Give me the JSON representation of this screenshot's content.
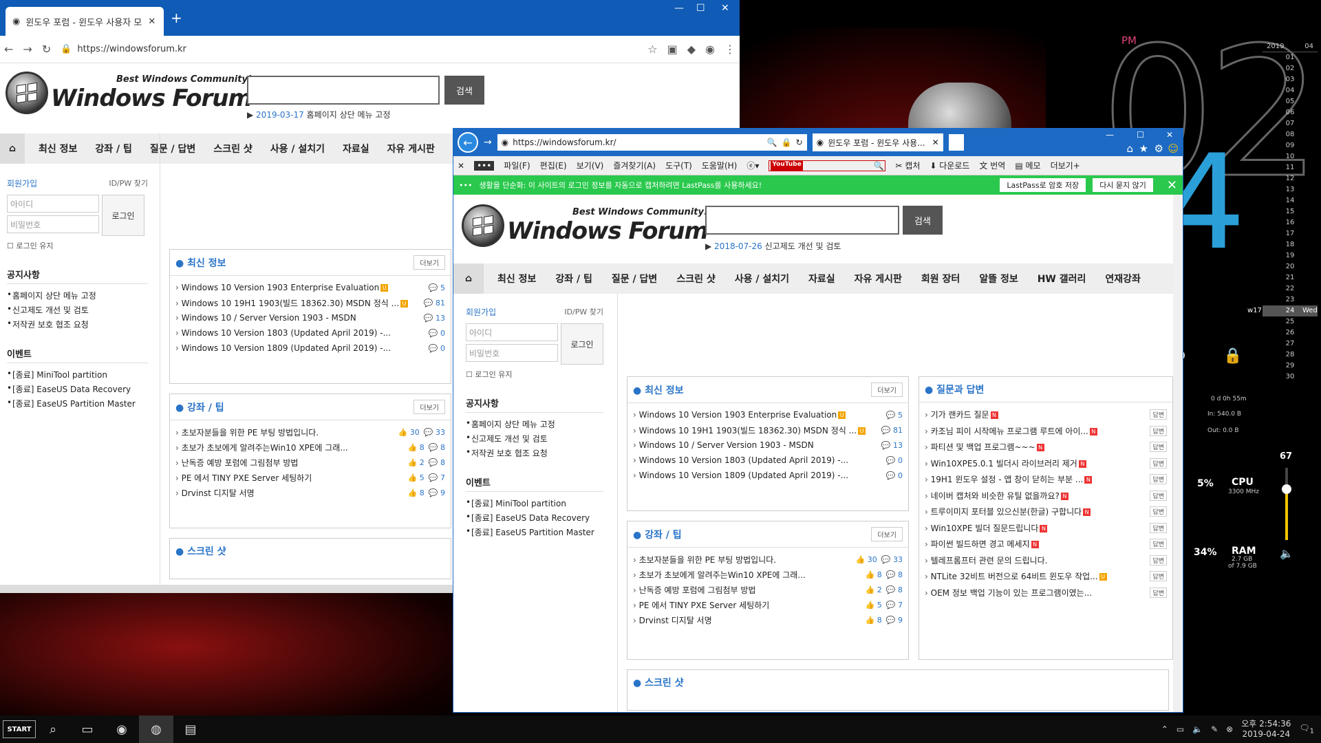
{
  "desktop": {
    "pm": "PM",
    "hour": "02",
    "minute": "4",
    "calendar": {
      "year": "2019",
      "month": "04",
      "days": [
        "01",
        "02",
        "03",
        "04",
        "05",
        "06",
        "07",
        "08",
        "09",
        "10",
        "11",
        "12",
        "13",
        "14",
        "15",
        "16",
        "17",
        "18",
        "19",
        "20",
        "21",
        "22",
        "23",
        "24",
        "25",
        "26",
        "27",
        "28",
        "29",
        "30"
      ],
      "week": "w17",
      "today": "24",
      "weekday": "Wed"
    },
    "uptime": "0 d 0h 55m",
    "net_in": "In: 540.0 B",
    "net_out": "Out: 0.0 B",
    "cpu_pct": "5%",
    "cpu_label": "CPU",
    "cpu_freq": "3300 MHz",
    "ram_pct": "34%",
    "ram_label": "RAM",
    "ram_used": "2.7 GB",
    "ram_total": "of 7.9 GB",
    "volume": "67"
  },
  "chrome": {
    "tab_title": "윈도우 포럼 - 윈도우 사용자 모임",
    "url": "https://windowsforum.kr",
    "notice_date": "2019-03-17",
    "notice_text": "홈페이지 상단 메뉴 고정"
  },
  "ie": {
    "url": "https://windowsforum.kr/",
    "tab_title": "윈도우 포럼 - 윈도우 사용...",
    "menu": [
      "파일(F)",
      "편집(E)",
      "보기(V)",
      "즐겨찾기(A)",
      "도구(T)",
      "도움말(H)"
    ],
    "toolbar": [
      "캡처",
      "다운로드",
      "번역",
      "메모",
      "더보기+"
    ],
    "youtube": "YouTube",
    "lastpass_msg": "생활을 단순화: 이 사이트의 로그인 정보를 자동으로 캡처하려면 LastPass를 사용하세요!",
    "lastpass_btn1": "LastPass로 암호 저장",
    "lastpass_btn2": "다시 묻지 않기",
    "notice_date": "2018-07-26",
    "notice_text": "신고제도 개선 및 검토"
  },
  "site": {
    "tagline": "Best Windows Community!",
    "logo": "Windows Forum",
    "search_btn": "검색",
    "nav": [
      "최신 정보",
      "강좌 / 팁",
      "질문 / 답변",
      "스크린 샷",
      "사용 / 설치기",
      "자료실",
      "자유 게시판",
      "회원 장터",
      "알뜰 정보",
      "HW 갤러리",
      "연재강좌"
    ],
    "signup": "회원가입",
    "find": "ID/PW 찾기",
    "id_ph": "아이디",
    "pw_ph": "비밀번호",
    "login": "로그인",
    "keep": "로그인 유지",
    "notice_h": "공지사항",
    "notices": [
      "홈페이지 상단 메뉴 고정",
      "신고제도 개선 및 검토",
      "저작권 보호 협조 요청"
    ],
    "event_h": "이벤트",
    "events": [
      "[종료] MiniTool partition",
      "[종료] EaseUS Data Recovery",
      "[종료] EaseUS Partition Master"
    ],
    "more": "더보기",
    "latest_h": "최신 정보",
    "latest": [
      {
        "t": "Windows 10 Version 1903 Enterprise Evaluation",
        "c": "5",
        "b": true
      },
      {
        "t": "Windows 10 19H1 1903(빌드 18362.30) MSDN 정식 ...",
        "c": "81",
        "b": true
      },
      {
        "t": "Windows 10 / Server Version 1903 - MSDN",
        "c": "13",
        "b": false
      },
      {
        "t": "Windows 10 Version 1803 (Updated April 2019) -...",
        "c": "0",
        "b": false
      },
      {
        "t": "Windows 10 Version 1809 (Updated April 2019) -...",
        "c": "0",
        "b": false
      }
    ],
    "tips_h": "강좌 / 팁",
    "tips": [
      {
        "t": "초보자분들을 위한 PE 부팅 방법입니다.",
        "l": "30",
        "c": "33"
      },
      {
        "t": "초보가 초보에게 알려주는Win10 XPE에 그래...",
        "l": "8",
        "c": "8"
      },
      {
        "t": "난독증 예방 포럼에 그림첨부 방법",
        "l": "2",
        "c": "8"
      },
      {
        "t": "PE 에서 TINY PXE Server 세팅하기",
        "l": "5",
        "c": "7"
      },
      {
        "t": "Drvinst 디지탈 서명",
        "l": "8",
        "c": "9"
      }
    ],
    "qa_h": "질문과 답변",
    "ans": "답변",
    "qa": [
      {
        "t": "기가 랜카드 질문",
        "n": "N"
      },
      {
        "t": "카조님 피이 시작메뉴 프로그램 루트에 아이...",
        "n": "N"
      },
      {
        "t": "파티션 및 백업 프로그램~~~",
        "n": "N"
      },
      {
        "t": "Win10XPE5.0.1 빌더시 라이브러리 제거",
        "n": "N"
      },
      {
        "t": "19H1 윈도우 설정 - 앱 창이 닫히는 부분 ...",
        "n": "N"
      },
      {
        "t": "네이버 캡처와 비슷한 유틸 없을까요?",
        "n": "N"
      },
      {
        "t": "트루이미지 포터블 있으신분(한글) 구합니다",
        "n": "N"
      },
      {
        "t": "Win10XPE 빌더 질문드립니다",
        "n": "N"
      },
      {
        "t": "파이썬 빌드하면 경고 메세지",
        "n": "N"
      },
      {
        "t": "텔레프롬프터 관련 문의 드립니다.",
        "n": ""
      },
      {
        "t": "NTLite 32비트 버전으로 64비트 윈도우 작업...",
        "n": "U"
      },
      {
        "t": "OEM 정보 백업 기능이 있는 프로그램이였는...",
        "n": ""
      }
    ],
    "shots_h": "스크린 샷"
  },
  "taskbar": {
    "start": "START",
    "time": "오후 2:54:36",
    "date": "2019-04-24",
    "notif": "1"
  }
}
